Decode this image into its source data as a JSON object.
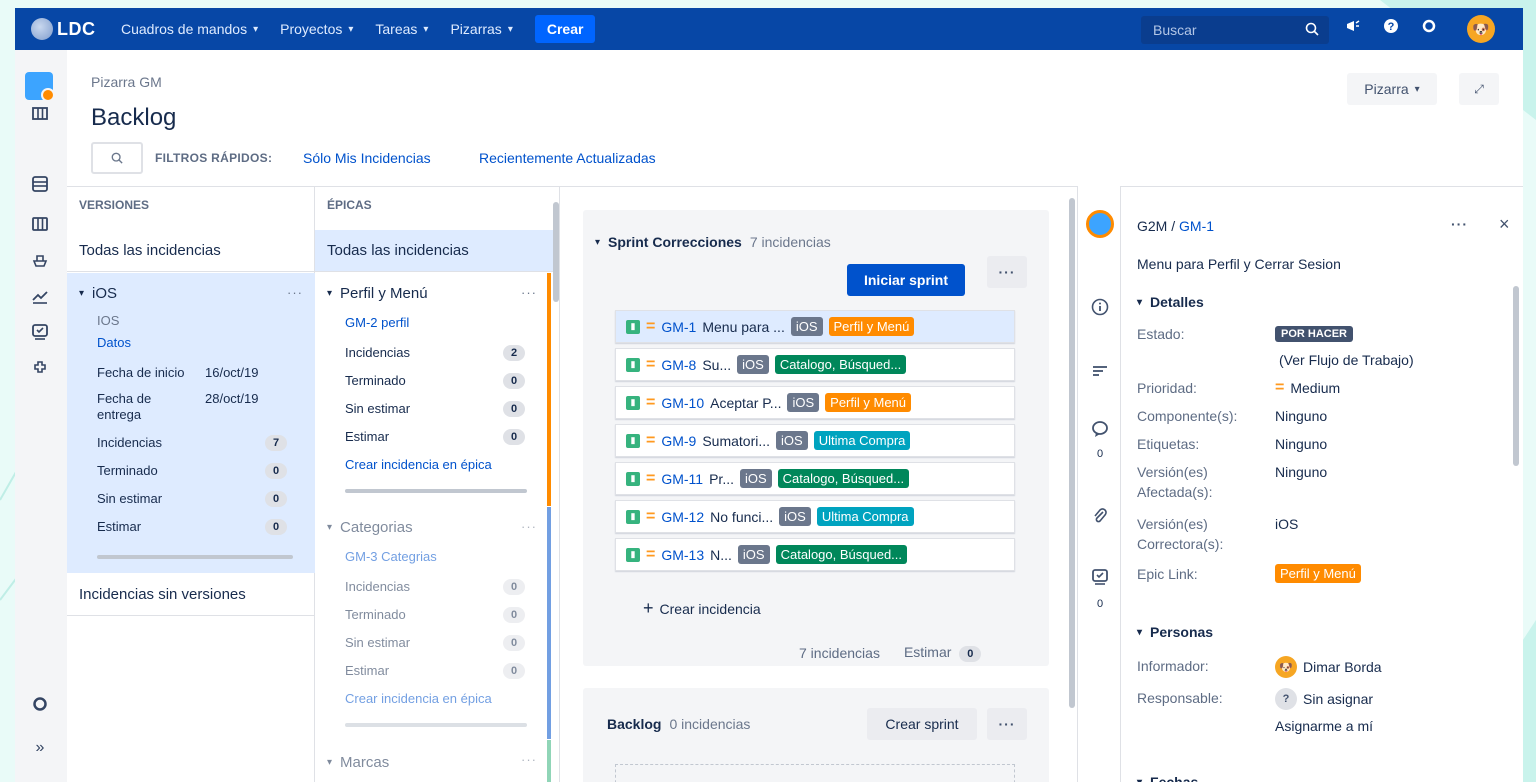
{
  "nav": {
    "logo": "LDC",
    "items": [
      {
        "label": "Cuadros de mandos"
      },
      {
        "label": "Proyectos"
      },
      {
        "label": "Tareas"
      },
      {
        "label": "Pizarras"
      }
    ],
    "create": "Crear",
    "search_placeholder": "Buscar"
  },
  "header": {
    "breadcrumb": "Pizarra GM",
    "title": "Backlog",
    "board_btn": "Pizarra",
    "quick_filters_label": "FILTROS RÁPIDOS:",
    "filter1": "Sólo Mis Incidencias",
    "filter2": "Recientemente Actualizadas"
  },
  "versions": {
    "heading": "VERSIONES",
    "all": "Todas las incidencias",
    "item": {
      "name": "iOS",
      "sub": "IOS",
      "link": "Datos",
      "start_label": "Fecha de inicio",
      "start": "16/oct/19",
      "end_label": "Fecha de entrega",
      "end": "28/oct/19",
      "rows": [
        {
          "label": "Incidencias",
          "count": "7"
        },
        {
          "label": "Terminado",
          "count": "0"
        },
        {
          "label": "Sin estimar",
          "count": "0"
        },
        {
          "label": "Estimar",
          "count": "0"
        }
      ]
    },
    "no_versions": "Incidencias sin versiones"
  },
  "epics": {
    "heading": "ÉPICAS",
    "all": "Todas las incidencias",
    "items": [
      {
        "name": "Perfil y Menú",
        "key": "GM-2",
        "sub": "perfil",
        "rows": [
          {
            "label": "Incidencias",
            "count": "2"
          },
          {
            "label": "Terminado",
            "count": "0"
          },
          {
            "label": "Sin estimar",
            "count": "0"
          },
          {
            "label": "Estimar",
            "count": "0"
          }
        ],
        "create": "Crear incidencia en épica",
        "color": "#ff8b00"
      },
      {
        "name": "Categorias",
        "key": "GM-3",
        "sub": "Categrias",
        "rows": [
          {
            "label": "Incidencias",
            "count": "0"
          },
          {
            "label": "Terminado",
            "count": "0"
          },
          {
            "label": "Sin estimar",
            "count": "0"
          },
          {
            "label": "Estimar",
            "count": "0"
          }
        ],
        "create": "Crear incidencia en épica",
        "color": "#0052cc"
      },
      {
        "name": "Marcas",
        "color": "#36b37e"
      }
    ]
  },
  "sprint": {
    "name": "Sprint Correcciones",
    "count": "7 incidencias",
    "start_btn": "Iniciar sprint",
    "issues": [
      {
        "key": "GM-1",
        "summary": "Menu para ...",
        "ver": "iOS",
        "epic": "Perfil y Menú",
        "epic_color": "orange"
      },
      {
        "key": "GM-8",
        "summary": "Su...",
        "ver": "iOS",
        "epic": "Catalogo, Búsqued...",
        "epic_color": "green"
      },
      {
        "key": "GM-10",
        "summary": "Aceptar P...",
        "ver": "iOS",
        "epic": "Perfil y Menú",
        "epic_color": "orange"
      },
      {
        "key": "GM-9",
        "summary": "Sumatori...",
        "ver": "iOS",
        "epic": "Ultima Compra",
        "epic_color": "teal"
      },
      {
        "key": "GM-11",
        "summary": "Pr...",
        "ver": "iOS",
        "epic": "Catalogo, Búsqued...",
        "epic_color": "green"
      },
      {
        "key": "GM-12",
        "summary": "No funci...",
        "ver": "iOS",
        "epic": "Ultima Compra",
        "epic_color": "teal"
      },
      {
        "key": "GM-13",
        "summary": "N...",
        "ver": "iOS",
        "epic": "Catalogo, Búsqued...",
        "epic_color": "green"
      }
    ],
    "create_issue": "Crear incidencia",
    "footer_count": "7 incidencias",
    "footer_estimate": "Estimar",
    "footer_estimate_value": "0"
  },
  "backlog": {
    "name": "Backlog",
    "count": "0 incidencias",
    "create_sprint": "Crear sprint"
  },
  "strip": {
    "comments": "0",
    "subtasks": "0"
  },
  "detail": {
    "project": "G2M",
    "separator": "/",
    "key": "GM-1",
    "summary": "Menu para Perfil y Cerrar Sesion",
    "details_heading": "Detalles",
    "status_label": "Estado:",
    "status": "POR HACER",
    "workflow": "(Ver Flujo de Trabajo)",
    "priority_label": "Prioridad:",
    "priority": "Medium",
    "component_label": "Componente(s):",
    "component": "Ninguno",
    "labels_label": "Etiquetas:",
    "labels": "Ninguno",
    "affects_label_1": "Versión(es)",
    "affects_label_2": "Afectada(s):",
    "affects": "Ninguno",
    "fix_label_1": "Versión(es)",
    "fix_label_2": "Correctora(s):",
    "fix": "iOS",
    "epic_label": "Epic Link:",
    "epic": "Perfil y Menú",
    "people_heading": "Personas",
    "reporter_label": "Informador:",
    "reporter": "Dimar Borda",
    "assignee_label": "Responsable:",
    "assignee": "Sin asignar",
    "assign_me": "Asignarme a mí",
    "dates_heading": "Fechas"
  }
}
